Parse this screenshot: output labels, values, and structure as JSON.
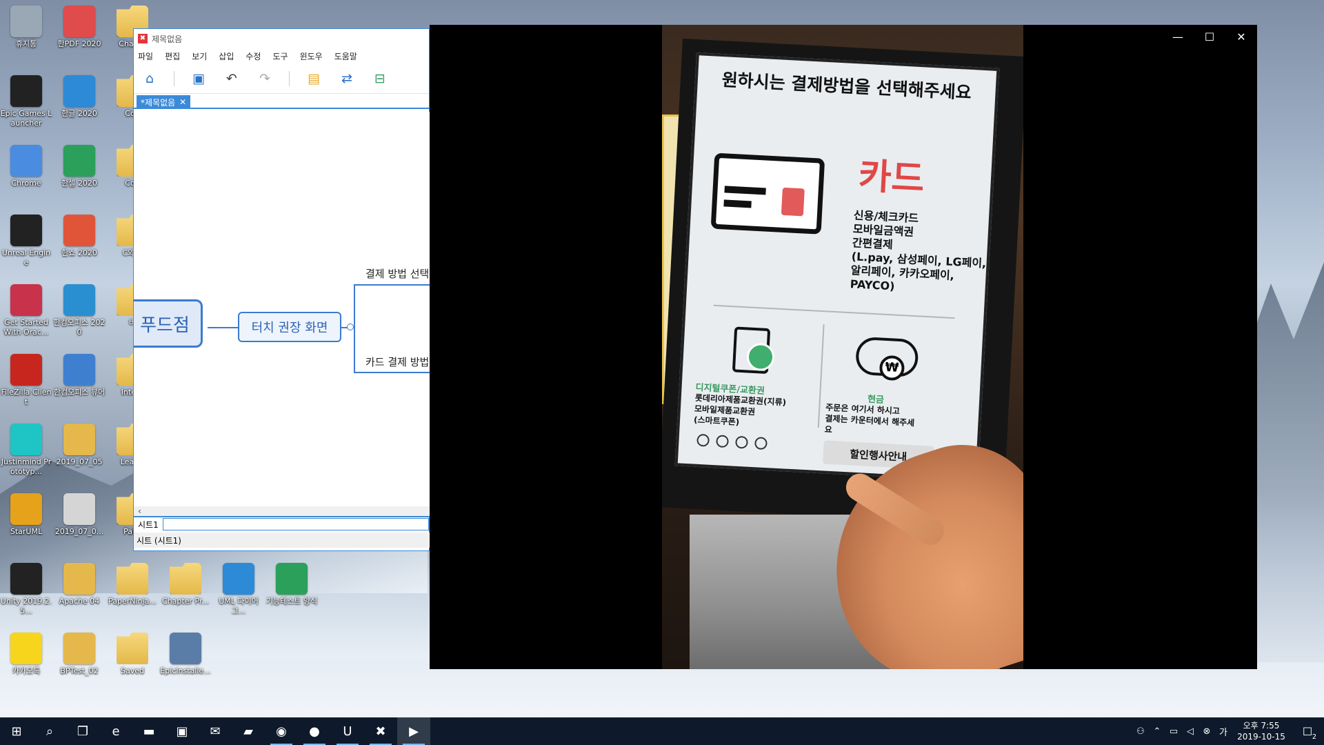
{
  "desktop": {
    "icons": [
      {
        "label": "휴지통",
        "icon": "recycle-bin-icon",
        "color": "#9aa7b5"
      },
      {
        "label": "한PDF 2020",
        "icon": "hanpdf-icon",
        "color": "#e04b4b"
      },
      {
        "label": "Chapte",
        "icon": "folder-icon",
        "color": "#e4b84a"
      },
      {
        "label": "Epic Games Launcher",
        "icon": "epic-games-icon",
        "color": "#222222"
      },
      {
        "label": "한글 2020",
        "icon": "hangul-icon",
        "color": "#2d8ad6"
      },
      {
        "label": "Con",
        "icon": "folder-icon",
        "color": "#e4b84a"
      },
      {
        "label": "Chrome",
        "icon": "chrome-icon",
        "color": "#4a8de0"
      },
      {
        "label": "한셀 2020",
        "icon": "hancell-icon",
        "color": "#2aa05a"
      },
      {
        "label": "Con",
        "icon": "folder-icon",
        "color": "#e4b84a"
      },
      {
        "label": "Unreal Engine",
        "icon": "unreal-icon",
        "color": "#222222"
      },
      {
        "label": "한쇼 2020",
        "icon": "hanshow-icon",
        "color": "#e0553a"
      },
      {
        "label": "C와 C",
        "icon": "folder-icon",
        "color": "#e4b84a"
      },
      {
        "label": "Get Started With Orac...",
        "icon": "oracle-icon",
        "color": "#c8324a"
      },
      {
        "label": "한컴오피스 2020",
        "icon": "hancom-office-icon",
        "color": "#2a8fd0"
      },
      {
        "label": "버",
        "icon": "folder-icon",
        "color": "#e4b84a"
      },
      {
        "label": "FileZilla Client",
        "icon": "filezilla-icon",
        "color": "#c7261f"
      },
      {
        "label": "한컴오피스 뷰어",
        "icon": "hancom-viewer-icon",
        "color": "#3f7fd0"
      },
      {
        "label": "Intern",
        "icon": "folder-icon",
        "color": "#e4b84a"
      },
      {
        "label": "Justinmind Prototyp...",
        "icon": "justinmind-icon",
        "color": "#1fc4c4"
      },
      {
        "label": "2019_07_05",
        "icon": "document-icon",
        "color": "#e4b84a"
      },
      {
        "label": "LeapU",
        "icon": "folder-icon",
        "color": "#e4b84a"
      },
      {
        "label": "StarUML",
        "icon": "staruml-icon",
        "color": "#e5a21a"
      },
      {
        "label": "2019_07_0...",
        "icon": "document-icon",
        "color": "#d5d5d5"
      },
      {
        "label": "Pallo",
        "icon": "folder-icon",
        "color": "#e4b84a"
      },
      {
        "label": "Unity 2019.2.5...",
        "icon": "unity-icon",
        "color": "#222222"
      },
      {
        "label": "Apache 04",
        "icon": "uproject-icon",
        "color": "#e4b84a"
      },
      {
        "label": "PaperNinja...",
        "icon": "folder-icon",
        "color": "#e4b84a"
      },
      {
        "label": "Chapter Pr...",
        "icon": "zip-folder-icon",
        "color": "#e4b84a"
      },
      {
        "label": "UML 다이어그...",
        "icon": "hangul-doc-icon",
        "color": "#2d8ad6"
      },
      {
        "label": "기능테스트 양식",
        "icon": "hancell-doc-icon",
        "color": "#2aa05a"
      },
      {
        "label": "카카오톡",
        "icon": "kakaotalk-icon",
        "color": "#f7d51d"
      },
      {
        "label": "BPTest_02",
        "icon": "uproject-icon",
        "color": "#e4b84a"
      },
      {
        "label": "Saved",
        "icon": "folder-icon",
        "color": "#e4b84a"
      },
      {
        "label": "EpicInstalle...",
        "icon": "installer-icon",
        "color": "#5a7da8"
      }
    ]
  },
  "xmind": {
    "title": "제목없음",
    "menu": [
      "파일",
      "편집",
      "보기",
      "삽입",
      "수정",
      "도구",
      "윈도우",
      "도움말"
    ],
    "tab_label": "*제목없음",
    "central_topic": "푸드점",
    "main_topic": "터치 권장 화면",
    "subtopics": [
      "결제 방법 선택",
      "카드 결제 방법"
    ],
    "sheet_tab": "시트1",
    "status": "시트 (시트1)"
  },
  "video": {
    "kiosk_heading": "원하시는 결제방법을 선택해주세요",
    "card_title": "카드",
    "card_desc": "신용/체크카드\n모바일금액권\n간편결제\n(L.pay, 삼성페이, LG페이,\n알리페이, 카카오페이,\nPAYCO)",
    "coupon_title": "디지털쿠폰/교환권",
    "coupon_desc": "롯데리아제품교환권(지류)\n모바일제품교환권\n(스마트쿠폰)",
    "cash_title": "현금",
    "cash_desc": "주문은 여기서 하시고\n결제는 카운터에서 해주세\n요",
    "discount_button": "할인행사안내",
    "win_controls": {
      "minimize": "—",
      "maximize": "☐",
      "close": "✕"
    }
  },
  "taskbar": {
    "items": [
      {
        "name": "start-icon",
        "glyph": "⊞"
      },
      {
        "name": "search-icon",
        "glyph": "⌕"
      },
      {
        "name": "task-view-icon",
        "glyph": "❐"
      },
      {
        "name": "edge-icon",
        "glyph": "e"
      },
      {
        "name": "file-explorer-icon",
        "glyph": "▬"
      },
      {
        "name": "store-icon",
        "glyph": "▣"
      },
      {
        "name": "mail-icon",
        "glyph": "✉"
      },
      {
        "name": "sticky-notes-icon",
        "glyph": "▰"
      },
      {
        "name": "chrome-icon",
        "glyph": "◉"
      },
      {
        "name": "app-icon",
        "glyph": "●"
      },
      {
        "name": "unreal-icon",
        "glyph": "U"
      },
      {
        "name": "xmind-icon",
        "glyph": "✖"
      },
      {
        "name": "video-player-icon",
        "glyph": "▶"
      }
    ],
    "clock_time": "오후 7:55",
    "clock_date": "2019-10-15",
    "notification_count": "2"
  },
  "colors": {
    "xmind_accent": "#3b8ad9",
    "taskbar_bg": "#0e1a2b",
    "card_red": "#e04747",
    "green_label": "#3a9960"
  }
}
